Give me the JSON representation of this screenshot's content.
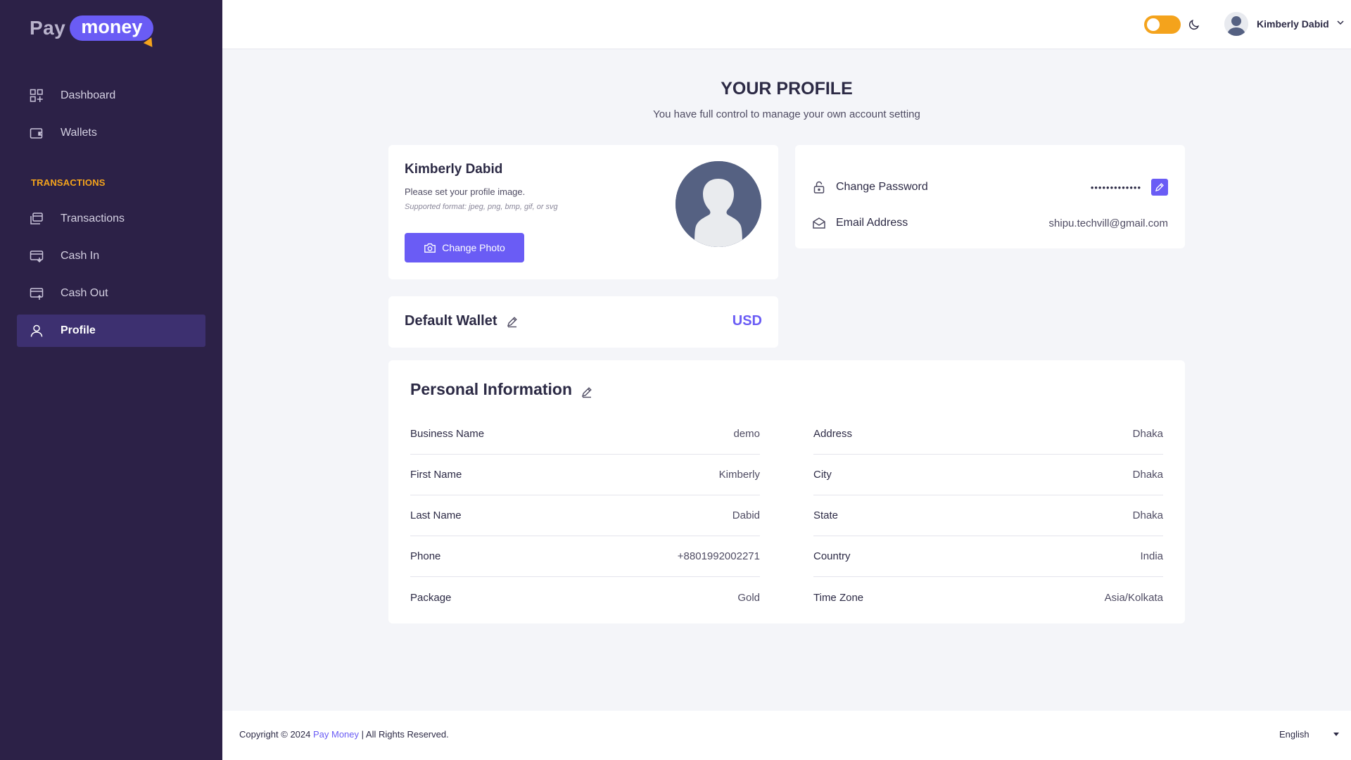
{
  "brand": {
    "word1": "Pay",
    "word2": "money"
  },
  "sidebar": {
    "items": [
      {
        "label": "Dashboard",
        "icon": "dashboard-icon"
      },
      {
        "label": "Wallets",
        "icon": "wallet-icon"
      },
      {
        "label": "Transactions",
        "icon": "transactions-icon"
      },
      {
        "label": "Cash In",
        "icon": "cash-in-icon"
      },
      {
        "label": "Cash Out",
        "icon": "cash-out-icon"
      },
      {
        "label": "Profile",
        "icon": "user-icon",
        "active": true
      }
    ],
    "section_label": "TRANSACTIONS"
  },
  "topbar": {
    "user_name": "Kimberly Dabid",
    "theme_toggle_on": true
  },
  "page": {
    "title": "YOUR PROFILE",
    "subtitle": "You have full control to manage your own account setting"
  },
  "profile_card": {
    "name": "Kimberly Dabid",
    "hint": "Please set your profile image.",
    "formats": "Supported format: jpeg, png, bmp, gif, or svg",
    "button": "Change Photo"
  },
  "security_card": {
    "password_label": "Change Password",
    "password_mask": "•••••••••••••",
    "email_label": "Email Address",
    "email_value": "shipu.techvill@gmail.com"
  },
  "wallet_card": {
    "label": "Default Wallet",
    "value": "USD"
  },
  "personal": {
    "title": "Personal Information",
    "left": [
      {
        "key": "Business Name",
        "value": "demo"
      },
      {
        "key": "First Name",
        "value": "Kimberly"
      },
      {
        "key": "Last Name",
        "value": "Dabid"
      },
      {
        "key": "Phone",
        "value": "+8801992002271"
      },
      {
        "key": "Package",
        "value": "Gold"
      }
    ],
    "right": [
      {
        "key": "Address",
        "value": "Dhaka"
      },
      {
        "key": "City",
        "value": "Dhaka"
      },
      {
        "key": "State",
        "value": "Dhaka"
      },
      {
        "key": "Country",
        "value": "India"
      },
      {
        "key": "Time Zone",
        "value": "Asia/Kolkata"
      }
    ]
  },
  "footer": {
    "copy_prefix": "Copyright © 2024",
    "brand": "Pay Money",
    "copy_suffix": "| All Rights Reserved.",
    "language": "English"
  },
  "colors": {
    "sidebar": "#2c2147",
    "accent": "#6a5cf5",
    "highlight": "#f4a31c"
  }
}
